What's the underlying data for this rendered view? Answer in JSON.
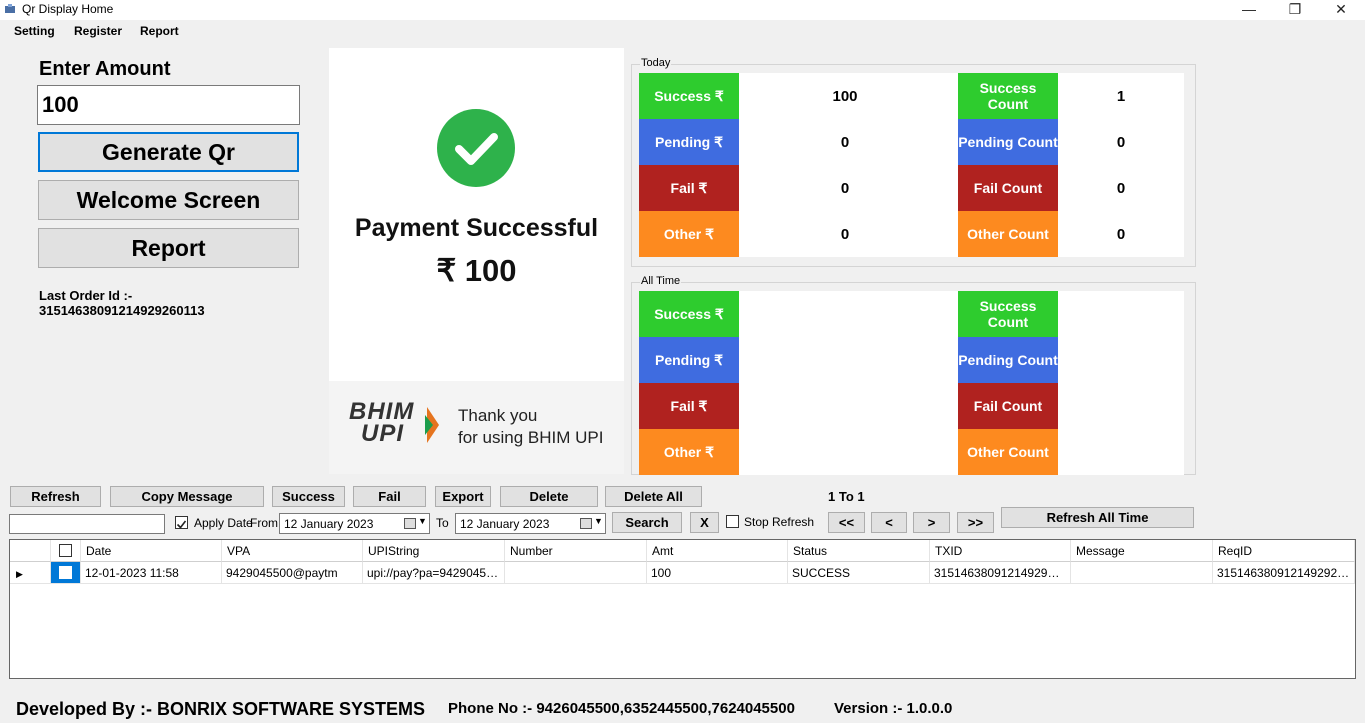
{
  "window": {
    "title": "Qr Display Home"
  },
  "menu": {
    "items": [
      "Setting",
      "Register",
      "Report"
    ]
  },
  "left": {
    "enter_amount_label": "Enter Amount",
    "amount_value": "100",
    "generate_btn": "Generate Qr",
    "welcome_btn": "Welcome Screen",
    "report_btn": "Report",
    "last_order_label": "Last Order Id :-",
    "last_order_id": "315146380912149292601​13"
  },
  "payment": {
    "status": "Payment Successful",
    "amount": "₹ 100",
    "logo_text_top": "BHIM",
    "logo_text_bottom": "UPI",
    "thanks_line1": "Thank you",
    "thanks_line2": "for using BHIM UPI"
  },
  "today": {
    "label": "Today",
    "left": [
      {
        "label": "Success ₹",
        "value": "100",
        "color": "#2ecc2e"
      },
      {
        "label": "Pending ₹",
        "value": "0",
        "color": "#3f6ce0"
      },
      {
        "label": "Fail    ₹",
        "value": "0",
        "color": "#b0221f"
      },
      {
        "label": "Other   ₹",
        "value": "0",
        "color": "#fd8a1f"
      }
    ],
    "right": [
      {
        "label": "Success Count",
        "value": "1"
      },
      {
        "label": "Pending Count",
        "value": "0"
      },
      {
        "label": "Fail Count",
        "value": "0"
      },
      {
        "label": "Other Count",
        "value": "0"
      }
    ]
  },
  "all_time": {
    "label": "All Time",
    "left": [
      "Success ₹",
      "Pending ₹",
      "Fail    ₹",
      "Other   ₹"
    ],
    "right": [
      "Success Count",
      "Pending Count",
      "Fail Count",
      "Other Count"
    ]
  },
  "toolbar": {
    "refresh": "Refresh",
    "copy": "Copy Message",
    "success": "Success",
    "fail": "Fail",
    "export": "Export",
    "delete": "Delete",
    "delete_all": "Delete All",
    "page_info": "1 To 1",
    "apply_date": "Apply Date",
    "from": "From",
    "to": "To",
    "from_date": "12   January   2023",
    "to_date": "12   January   2023",
    "search": "Search",
    "clear": "X",
    "stop_refresh": "Stop Refresh",
    "first": "<<",
    "prev": "<",
    "next": ">",
    "last": ">>",
    "refresh_all_time": "Refresh All Time"
  },
  "grid": {
    "columns": [
      "Date",
      "VPA",
      "UPIString",
      "Number",
      "Amt",
      "Status",
      "TXID",
      "Message",
      "ReqID"
    ],
    "rows": [
      [
        "12-01-2023 11:58",
        "9429045500@paytm",
        "upi://pay?pa=942904550...",
        "",
        "100",
        "SUCCESS",
        "31514638091214929260...",
        "",
        "31514638091214929260..."
      ]
    ]
  },
  "footer": {
    "developer": "Developed By :- BONRIX SOFTWARE SYSTEMS",
    "phone": "Phone No :- 9426045500,6352445500,7624045500",
    "version": "Version :- 1.0.0.0"
  }
}
